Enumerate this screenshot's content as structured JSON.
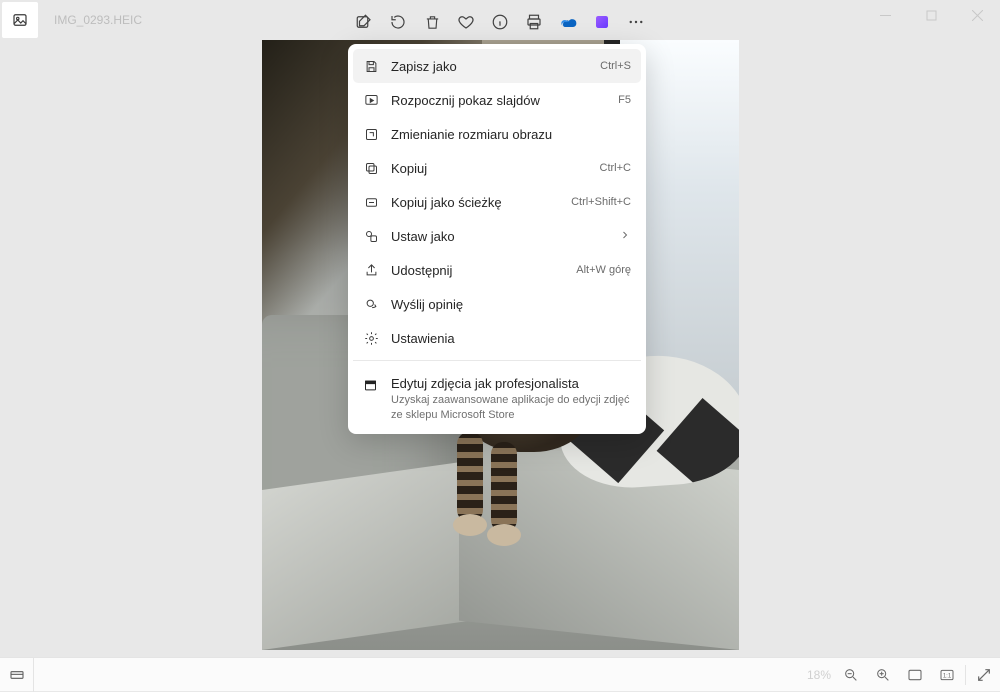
{
  "file_name": "IMG_0293.HEIC",
  "menu": {
    "save_as": {
      "label": "Zapisz jako",
      "accel": "Ctrl+S"
    },
    "slideshow": {
      "label": "Rozpocznij pokaz slajdów",
      "accel": "F5"
    },
    "resize": {
      "label": "Zmienianie rozmiaru obrazu"
    },
    "copy": {
      "label": "Kopiuj",
      "accel": "Ctrl+C"
    },
    "copy_path": {
      "label": "Kopiuj jako ścieżkę",
      "accel": "Ctrl+Shift+C"
    },
    "set_as": {
      "label": "Ustaw jako"
    },
    "share": {
      "label": "Udostępnij",
      "accel": "Alt+W górę"
    },
    "feedback": {
      "label": "Wyślij opinię"
    },
    "settings": {
      "label": "Ustawienia"
    },
    "promo_title": "Edytuj zdjęcia jak profesjonalista",
    "promo_desc": "Uzyskaj zaawansowane aplikacje do edycji zdjęć ze sklepu Microsoft Store"
  },
  "status": {
    "zoom": "18%"
  }
}
